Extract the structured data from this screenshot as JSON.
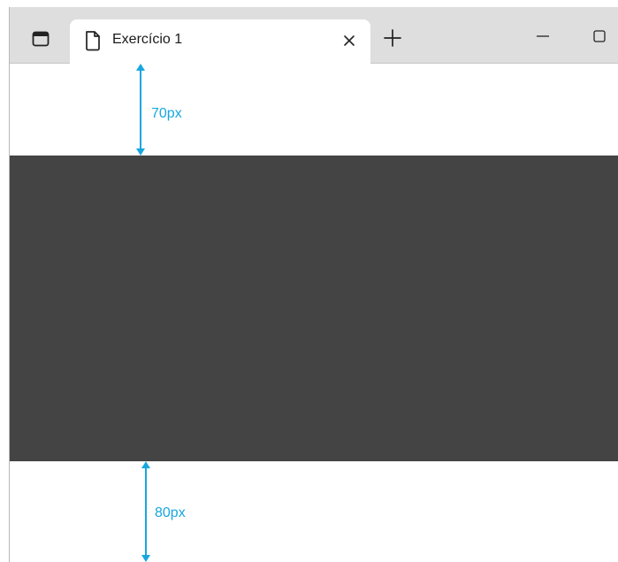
{
  "tab": {
    "title": "Exercício 1",
    "close_symbol": "✕",
    "icon": "document-icon"
  },
  "new_tab_symbol": "+",
  "window_controls": {
    "minimize_symbol": "—",
    "maximize_icon": "maximize-icon"
  },
  "content": {
    "top_margin_label": "70px",
    "bottom_margin_label": "80px",
    "box_color": "#444444",
    "annotation_color": "#17a7df"
  }
}
